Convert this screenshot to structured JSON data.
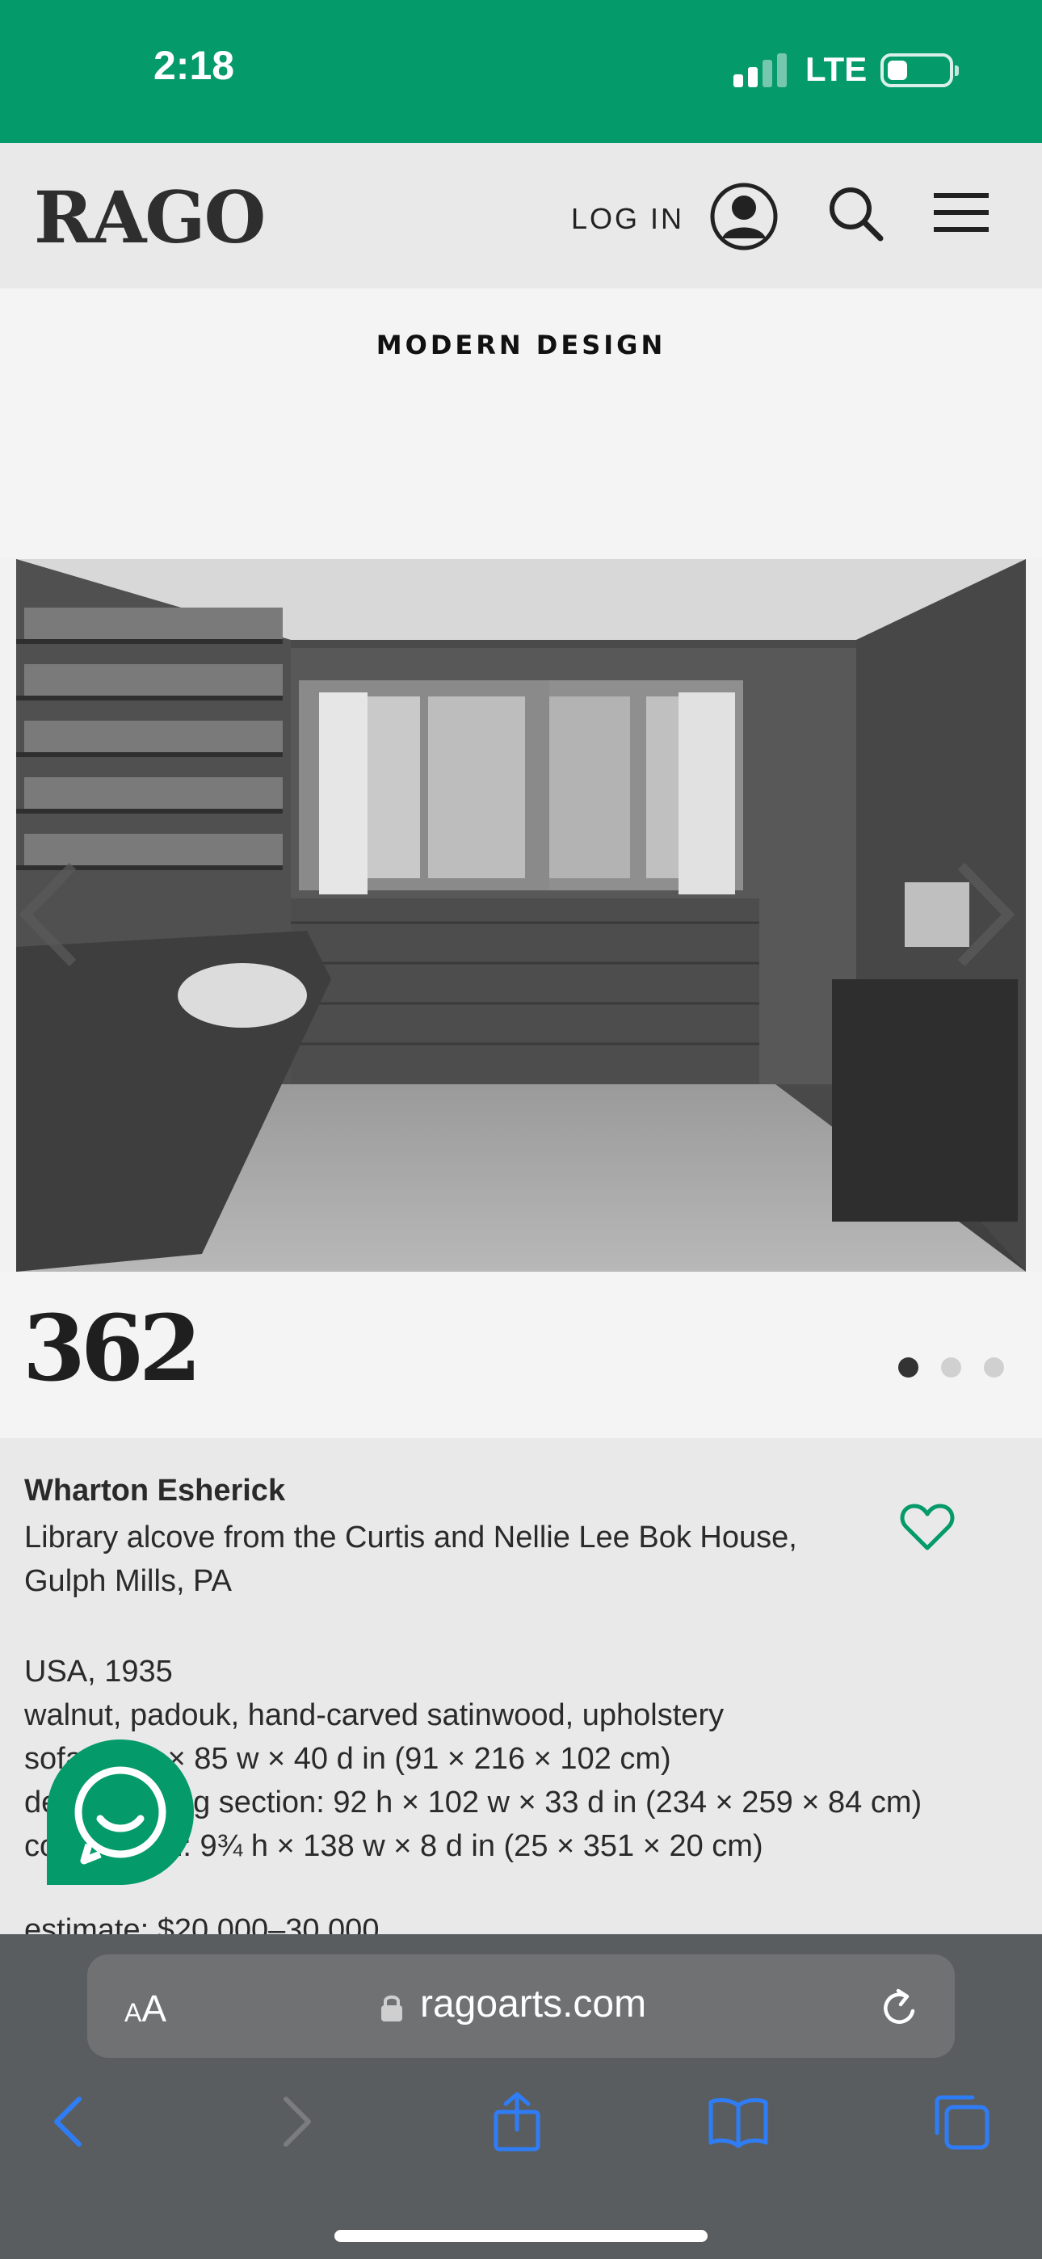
{
  "status_bar": {
    "time": "2:18",
    "network": "LTE",
    "color": "#049a6a"
  },
  "header": {
    "logo": "RAGO",
    "login_label": "LOG IN",
    "icons": [
      "user-icon",
      "search-icon",
      "menu-icon"
    ]
  },
  "category": "MODERN DESIGN",
  "gallery": {
    "image_description_icon": "photo",
    "current_index": 1,
    "total_images": 3
  },
  "lot": {
    "number": "362",
    "artist": "Wharton Esherick",
    "title": "Library alcove from the Curtis and Nellie Lee Bok House, Gulph Mills, PA",
    "specs": [
      "USA, 1935",
      "walnut, padouk, hand-carved satinwood, upholstery",
      "sofa: 36 h × 85 w × 40 d in (91 × 216 × 102 cm)",
      "desk/shelving section: 92 h × 102 w × 33 d in (234 × 259 × 84 cm)",
      "cornice trim: 9¾ h × 138 w × 8 d in (25 × 351 × 20 cm)"
    ],
    "estimate": "estimate: $20,000–30,000",
    "accent_color": "#049a6a"
  },
  "browser": {
    "aa_small": "A",
    "aa_big": "A",
    "url": "ragoarts.com"
  }
}
